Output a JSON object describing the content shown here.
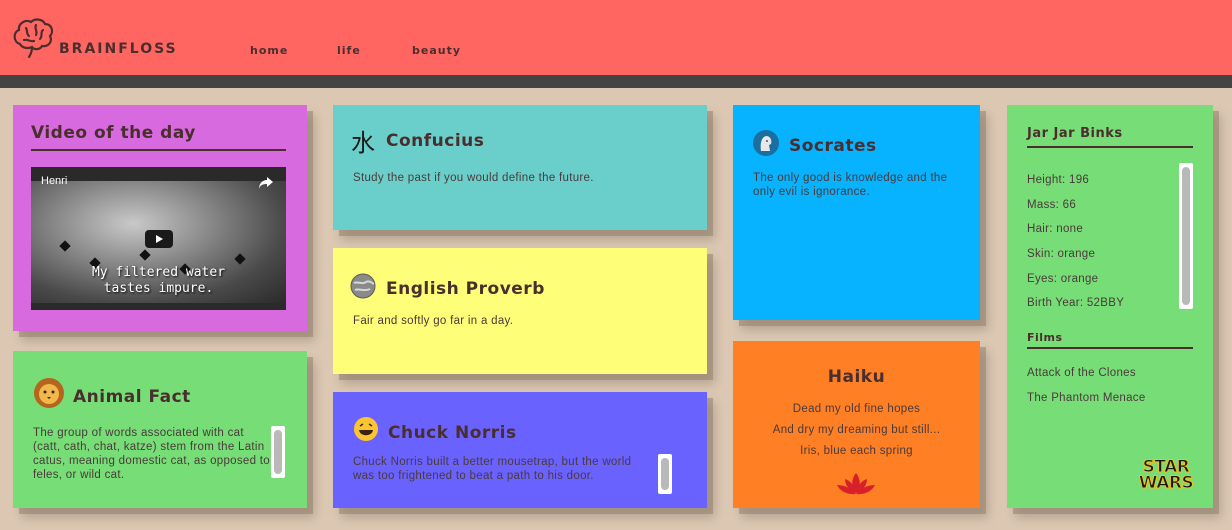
{
  "header": {
    "brand": "BRAINFLOSS",
    "nav": [
      "home",
      "life",
      "beauty"
    ]
  },
  "video_card": {
    "title": "Video of the day",
    "video_title": "Henri",
    "caption_line1": "My filtered water",
    "caption_line2": "tastes impure."
  },
  "animal_card": {
    "title": "Animal Fact",
    "text": "The group of words associated with cat (catt, cath, chat, katze) stem from the Latin catus, meaning domestic cat, as opposed to feles, or wild cat."
  },
  "confucius_card": {
    "title": "Confucius",
    "icon_glyph": "水",
    "text": "Study the past if you would define the future."
  },
  "proverb_card": {
    "title": "English Proverb",
    "text": "Fair and softly go far in a day."
  },
  "norris_card": {
    "title": "Chuck Norris",
    "text": "Chuck Norris built a better mousetrap, but the world was too frightened to beat a path to his door."
  },
  "socrates_card": {
    "title": "Socrates",
    "text": "The only good is knowledge and the only evil is ignorance."
  },
  "haiku_card": {
    "title": "Haiku",
    "lines": [
      "Dead my old fine hopes",
      "And dry my dreaming but still...",
      "Iris, blue each spring"
    ]
  },
  "jarjar_card": {
    "title": "Jar Jar Binks",
    "stats": [
      "Height: 196",
      "Mass: 66",
      "Hair: none",
      "Skin: orange",
      "Eyes: orange",
      "Birth Year: 52BBY"
    ],
    "films_title": "Films",
    "films": [
      "Attack of the Clones",
      "The Phantom Menace"
    ],
    "logo_line1": "STAR",
    "logo_line2": "WARS"
  },
  "colors": {
    "header": "#ff6662",
    "background": "#dcc8b2",
    "purple": "#d86ae0",
    "green": "#77dd77",
    "teal": "#6acfcb",
    "yellow": "#fefe78",
    "violet": "#6a62fe",
    "blue": "#07b2fe",
    "orange": "#fe7f24"
  }
}
